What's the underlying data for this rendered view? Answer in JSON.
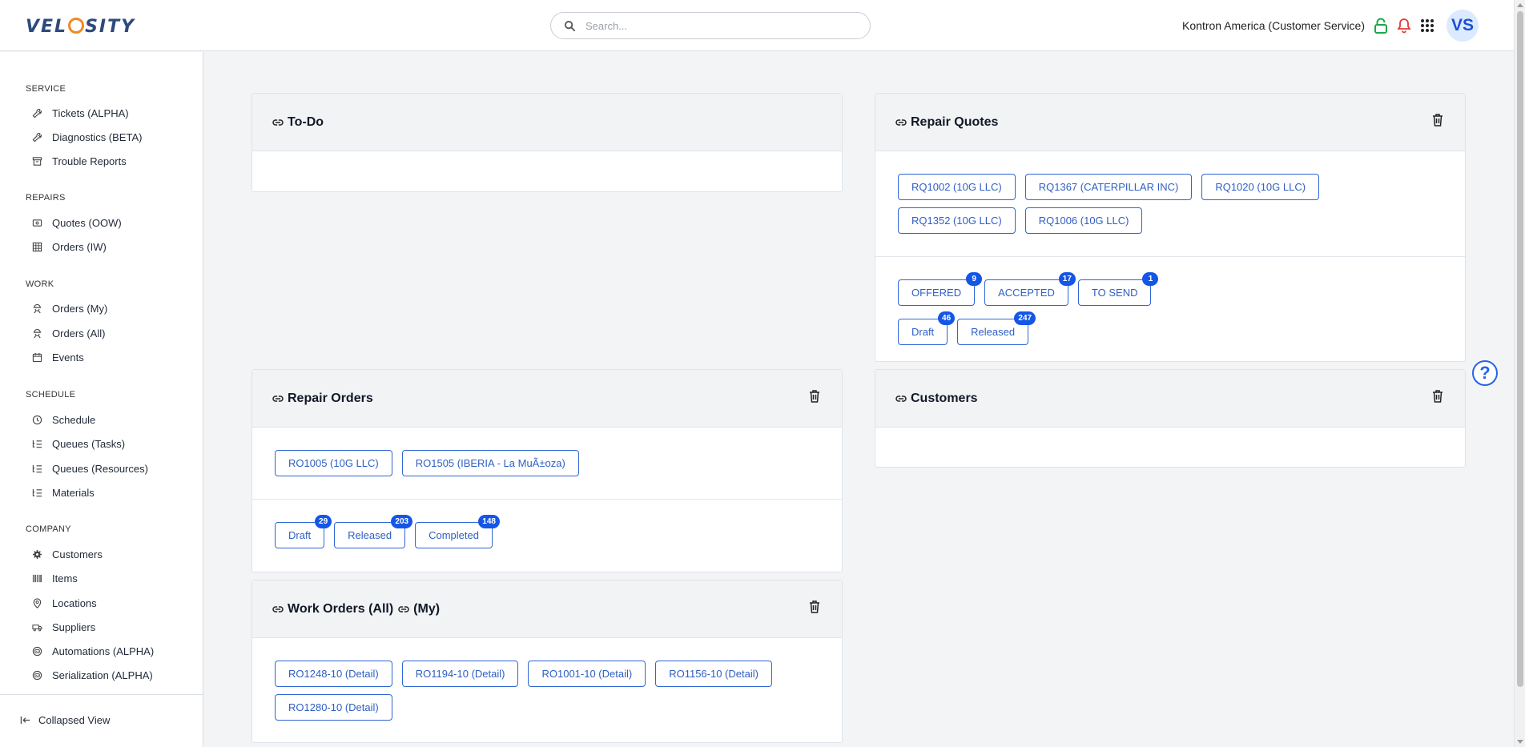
{
  "app": {
    "logo": [
      "VEL",
      "SITY"
    ]
  },
  "search": {
    "placeholder": "Search..."
  },
  "header": {
    "org": "Kontron America (Customer Service)",
    "avatar": "VS"
  },
  "sidebar": {
    "sections": [
      {
        "title": "SERVICE",
        "items": [
          {
            "label": "Tickets (ALPHA)",
            "icon": "wrench-icon"
          },
          {
            "label": "Diagnostics (BETA)",
            "icon": "wrench-icon"
          },
          {
            "label": "Trouble Reports",
            "icon": "archive-icon"
          }
        ]
      },
      {
        "title": "REPAIRS",
        "items": [
          {
            "label": "Quotes (OOW)",
            "icon": "quote-icon"
          },
          {
            "label": "Orders (IW)",
            "icon": "grid-icon"
          }
        ]
      },
      {
        "title": "WORK",
        "items": [
          {
            "label": "Orders (My)",
            "icon": "worker-icon"
          },
          {
            "label": "Orders (All)",
            "icon": "worker-icon"
          },
          {
            "label": "Events",
            "icon": "calendar-icon"
          }
        ]
      },
      {
        "title": "SCHEDULE",
        "items": [
          {
            "label": "Schedule",
            "icon": "clock-icon"
          },
          {
            "label": "Queues (Tasks)",
            "icon": "list-icon"
          },
          {
            "label": "Queues (Resources)",
            "icon": "list-icon"
          },
          {
            "label": "Materials",
            "icon": "list-icon"
          }
        ]
      },
      {
        "title": "COMPANY",
        "items": [
          {
            "label": "Customers",
            "icon": "gear-icon"
          },
          {
            "label": "Items",
            "icon": "barcode-icon"
          },
          {
            "label": "Locations",
            "icon": "pin-icon"
          },
          {
            "label": "Suppliers",
            "icon": "truck-icon"
          },
          {
            "label": "Automations (ALPHA)",
            "icon": "robot-icon"
          },
          {
            "label": "Serialization (ALPHA)",
            "icon": "robot-icon"
          }
        ]
      }
    ],
    "collapse_label": "Collapsed View"
  },
  "help": {
    "label": "?"
  },
  "cards": {
    "todo": {
      "title": "To-Do"
    },
    "repair_quotes": {
      "title": "Repair Quotes",
      "items": [
        "RQ1002 (10G LLC)",
        "RQ1367 (CATERPILLAR INC)",
        "RQ1020 (10G LLC)",
        "RQ1352 (10G LLC)",
        "RQ1006 (10G LLC)"
      ],
      "statuses": [
        {
          "label": "OFFERED",
          "count": "9"
        },
        {
          "label": "ACCEPTED",
          "count": "17"
        },
        {
          "label": "TO SEND",
          "count": "1"
        },
        {
          "label": "Draft",
          "count": "46"
        },
        {
          "label": "Released",
          "count": "247"
        }
      ]
    },
    "repair_orders": {
      "title": "Repair Orders",
      "items": [
        "RO1005 (10G LLC)",
        "RO1505 (IBERIA - La MuÃ±oza)"
      ],
      "statuses": [
        {
          "label": "Draft",
          "count": "29"
        },
        {
          "label": "Released",
          "count": "203"
        },
        {
          "label": "Completed",
          "count": "148"
        }
      ]
    },
    "customers": {
      "title": "Customers"
    },
    "work_orders": {
      "title": "Work Orders (All)",
      "title_suffix": "(My)",
      "items": [
        "RO1248-10 (Detail)",
        "RO1194-10 (Detail)",
        "RO1001-10 (Detail)",
        "RO1156-10 (Detail)",
        "RO1280-10 (Detail)"
      ]
    }
  },
  "colors": {
    "accent": "#2f66d4",
    "badge": "#1456e6",
    "lock": "#1ca84a",
    "bell": "#e53935",
    "logo_orange": "#f08a24"
  }
}
